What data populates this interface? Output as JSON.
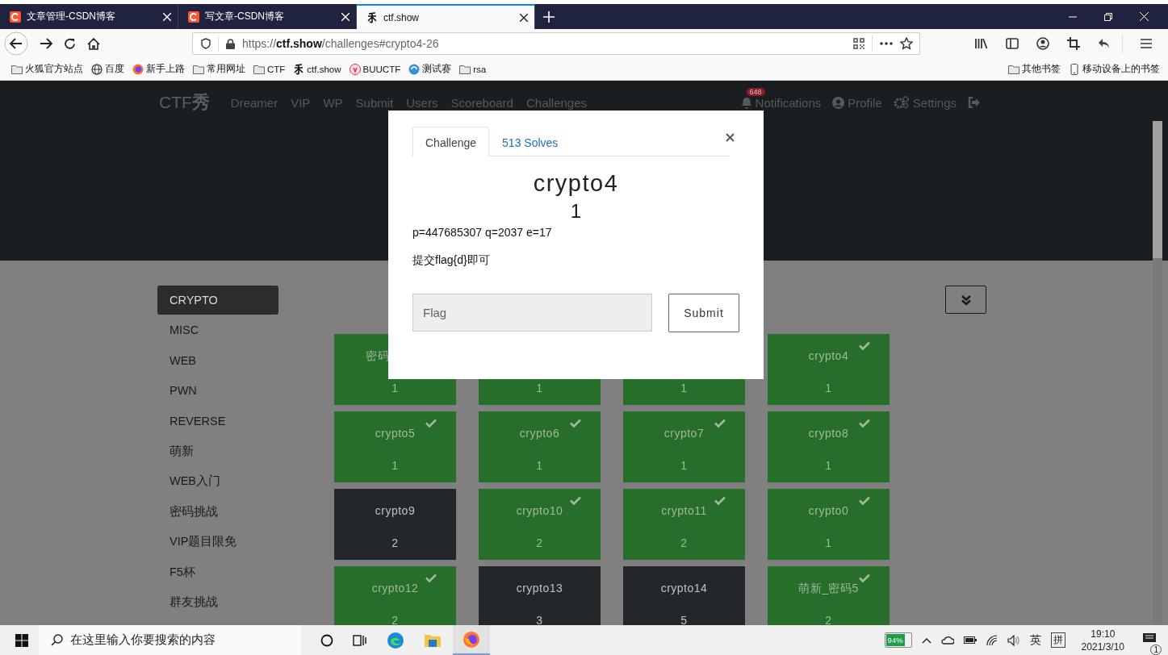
{
  "browser": {
    "tabs": [
      {
        "title": "文章管理-CSDN博客",
        "kind": "csdn",
        "selected": false
      },
      {
        "title": "写文章-CSDN博客",
        "kind": "csdn",
        "selected": false
      },
      {
        "title": "ctf.show",
        "kind": "ctf",
        "selected": true
      }
    ],
    "url": "https://**ctf.show**/challenges#crypto4-26",
    "bookmarks": [
      {
        "label": "火狐官方站点",
        "kind": "folder"
      },
      {
        "label": "百度",
        "kind": "globe"
      },
      {
        "label": "新手上路",
        "kind": "firefox"
      },
      {
        "label": "常用网址",
        "kind": "folder"
      },
      {
        "label": "CTF",
        "kind": "folder"
      },
      {
        "label": "ctf.show",
        "kind": "ctf"
      },
      {
        "label": "BUUCTF",
        "kind": "badge"
      },
      {
        "label": "测试赛",
        "kind": "swirl"
      },
      {
        "label": "rsa",
        "kind": "folder"
      }
    ],
    "bookmarks_right": [
      {
        "label": "其他书签",
        "kind": "folder"
      },
      {
        "label": "移动设备上的书签",
        "kind": "phone"
      }
    ]
  },
  "site": {
    "logo": {
      "text": "CTF",
      "mark": "秀"
    },
    "nav": [
      "Dreamer",
      "VIP",
      "WP",
      "Submit",
      "Users",
      "Scoreboard",
      "Challenges"
    ],
    "notifications": {
      "count": "648",
      "label": "Notifications"
    },
    "profile": "Profile",
    "settings": "Settings",
    "categories": [
      {
        "label": "CRYPTO",
        "selected": true
      },
      {
        "label": "MISC",
        "selected": false
      },
      {
        "label": "WEB",
        "selected": false
      },
      {
        "label": "PWN",
        "selected": false
      },
      {
        "label": "REVERSE",
        "selected": false
      },
      {
        "label": "萌新",
        "selected": false
      },
      {
        "label": "WEB入门",
        "selected": false
      },
      {
        "label": "密码挑战",
        "selected": false
      },
      {
        "label": "VIP题目限免",
        "selected": false
      },
      {
        "label": "F5杯",
        "selected": false
      },
      {
        "label": "群友挑战",
        "selected": false
      }
    ],
    "challenges": [
      {
        "title": "密码",
        "value": "1",
        "solved": true
      },
      {
        "value": "1",
        "solved": true
      },
      {
        "value": "1",
        "solved": true
      },
      {
        "title": "crypto4",
        "value": "1",
        "solved": true
      },
      {
        "title": "crypto5",
        "value": "1",
        "solved": true
      },
      {
        "title": "crypto6",
        "value": "1",
        "solved": true
      },
      {
        "title": "crypto7",
        "value": "1",
        "solved": true
      },
      {
        "title": "crypto8",
        "value": "1",
        "solved": true
      },
      {
        "title": "crypto9",
        "value": "2",
        "solved": false
      },
      {
        "title": "crypto10",
        "value": "2",
        "solved": true
      },
      {
        "title": "crypto11",
        "value": "2",
        "solved": true
      },
      {
        "title": "crypto0",
        "value": "1",
        "solved": true
      },
      {
        "title": "crypto12",
        "value": "2",
        "solved": true
      },
      {
        "title": "crypto13",
        "value": "3",
        "solved": false
      },
      {
        "title": "crypto14",
        "value": "5",
        "solved": false
      },
      {
        "title": "萌新_密码5",
        "value": "2",
        "solved": true
      }
    ]
  },
  "modal": {
    "tabs": [
      {
        "label": "Challenge",
        "selected": true
      },
      {
        "label": "513 Solves",
        "selected": false
      }
    ],
    "name": "crypto4",
    "value": "1",
    "description": [
      "p=447685307 q=2037 e=17",
      "提交flag{d}即可"
    ],
    "flag_placeholder": "Flag",
    "submit": "Submit"
  },
  "taskbar": {
    "search_placeholder": "在这里输入你要搜索的内容",
    "battery": "94%",
    "ime": [
      "英",
      "拼"
    ],
    "time": "19:10",
    "date": "2021/3/10",
    "notification_count": "1"
  }
}
